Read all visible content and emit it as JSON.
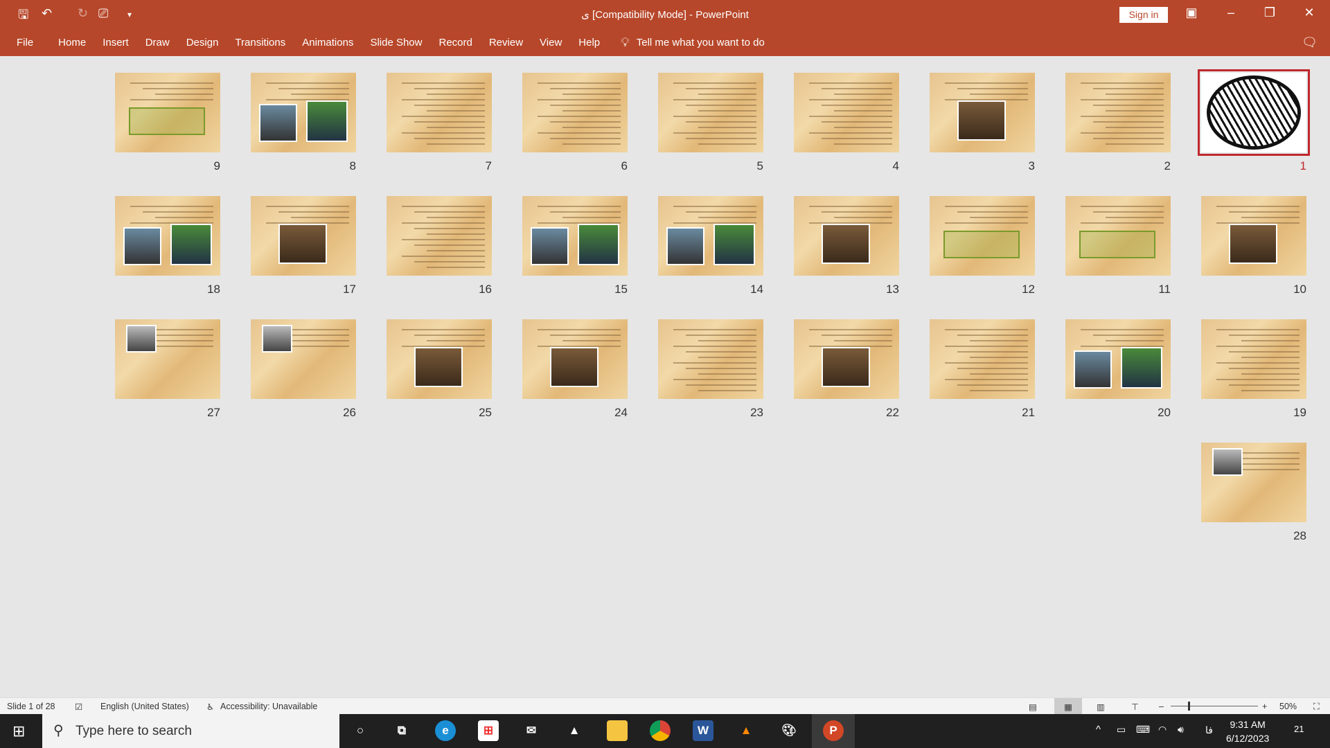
{
  "app": {
    "title": "ی [Compatibility Mode]  -  PowerPoint",
    "sign_in": "Sign in",
    "accent": "#b7472a"
  },
  "ribbon": {
    "tabs": [
      "File",
      "Home",
      "Insert",
      "Draw",
      "Design",
      "Transitions",
      "Animations",
      "Slide Show",
      "Record",
      "Review",
      "View",
      "Help"
    ],
    "tell_me": "Tell me what you want to do"
  },
  "slides": [
    {
      "n": "1",
      "selected": true,
      "type": "calligraphy"
    },
    {
      "n": "2",
      "type": "text"
    },
    {
      "n": "3",
      "type": "image"
    },
    {
      "n": "4",
      "type": "text"
    },
    {
      "n": "5",
      "type": "text"
    },
    {
      "n": "6",
      "type": "text"
    },
    {
      "n": "7",
      "type": "text"
    },
    {
      "n": "8",
      "type": "image2"
    },
    {
      "n": "9",
      "type": "diagram"
    },
    {
      "n": "10",
      "type": "image"
    },
    {
      "n": "11",
      "type": "diagram"
    },
    {
      "n": "12",
      "type": "diagram"
    },
    {
      "n": "13",
      "type": "image"
    },
    {
      "n": "14",
      "type": "image2"
    },
    {
      "n": "15",
      "type": "image2"
    },
    {
      "n": "16",
      "type": "text"
    },
    {
      "n": "17",
      "type": "image"
    },
    {
      "n": "18",
      "type": "image2"
    },
    {
      "n": "19",
      "type": "text"
    },
    {
      "n": "20",
      "type": "image2"
    },
    {
      "n": "21",
      "type": "text"
    },
    {
      "n": "22",
      "type": "image"
    },
    {
      "n": "23",
      "type": "text"
    },
    {
      "n": "24",
      "type": "image"
    },
    {
      "n": "25",
      "type": "image"
    },
    {
      "n": "26",
      "type": "portrait"
    },
    {
      "n": "27",
      "type": "portrait"
    },
    {
      "n": "28",
      "type": "portrait"
    }
  ],
  "status": {
    "slide": "Slide 1 of 28",
    "language": "English (United States)",
    "accessibility": "Accessibility: Unavailable",
    "zoom": "50%",
    "zoom_fraction": 0.5
  },
  "taskbar": {
    "search_placeholder": "Type here to search",
    "time": "9:31 AM",
    "date": "6/12/2023",
    "lang": "فا",
    "notifications": "21"
  }
}
